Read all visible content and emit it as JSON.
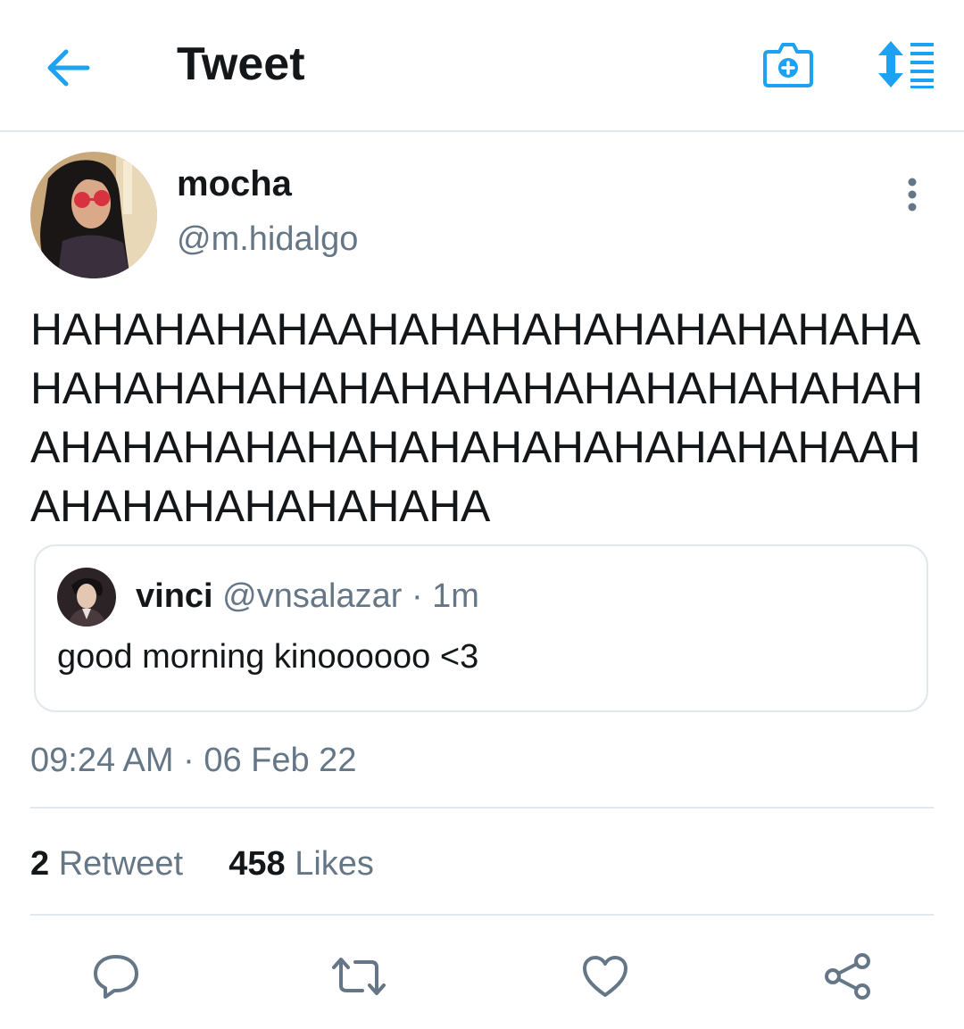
{
  "topbar": {
    "title": "Tweet",
    "icons": {
      "back": "arrow-left-icon",
      "camera": "camera-plus-icon",
      "sort": "sort-list-icon"
    }
  },
  "author": {
    "display_name": "mocha",
    "handle": "@m.hidalgo"
  },
  "tweet": {
    "text": "HAHAHAHAHAAHAHAHAHAHAHAHAHAHAHAHAHAHAHAHAHAHAHAHAHAHAHAHAHAHAHAHAHAHAHAHAHAHAHAHAHAHAAHAHAHAHAHAHAHAHA",
    "timestamp": "09:24 AM · 06 Feb 22"
  },
  "quote": {
    "display_name": "vinci",
    "handle": "@vnsalazar",
    "separator": "·",
    "time": "1m",
    "text": "good morning kinoooooo <3"
  },
  "stats": {
    "retweet_count": "2",
    "retweet_label": "Retweet",
    "like_count": "458",
    "like_label": "Likes"
  },
  "actions": [
    "reply-icon",
    "retweet-icon",
    "like-icon",
    "share-icon"
  ],
  "colors": {
    "accent": "#1da1f2",
    "text_primary": "#14171a",
    "text_secondary": "#657786",
    "divider": "#e1e8ed"
  }
}
